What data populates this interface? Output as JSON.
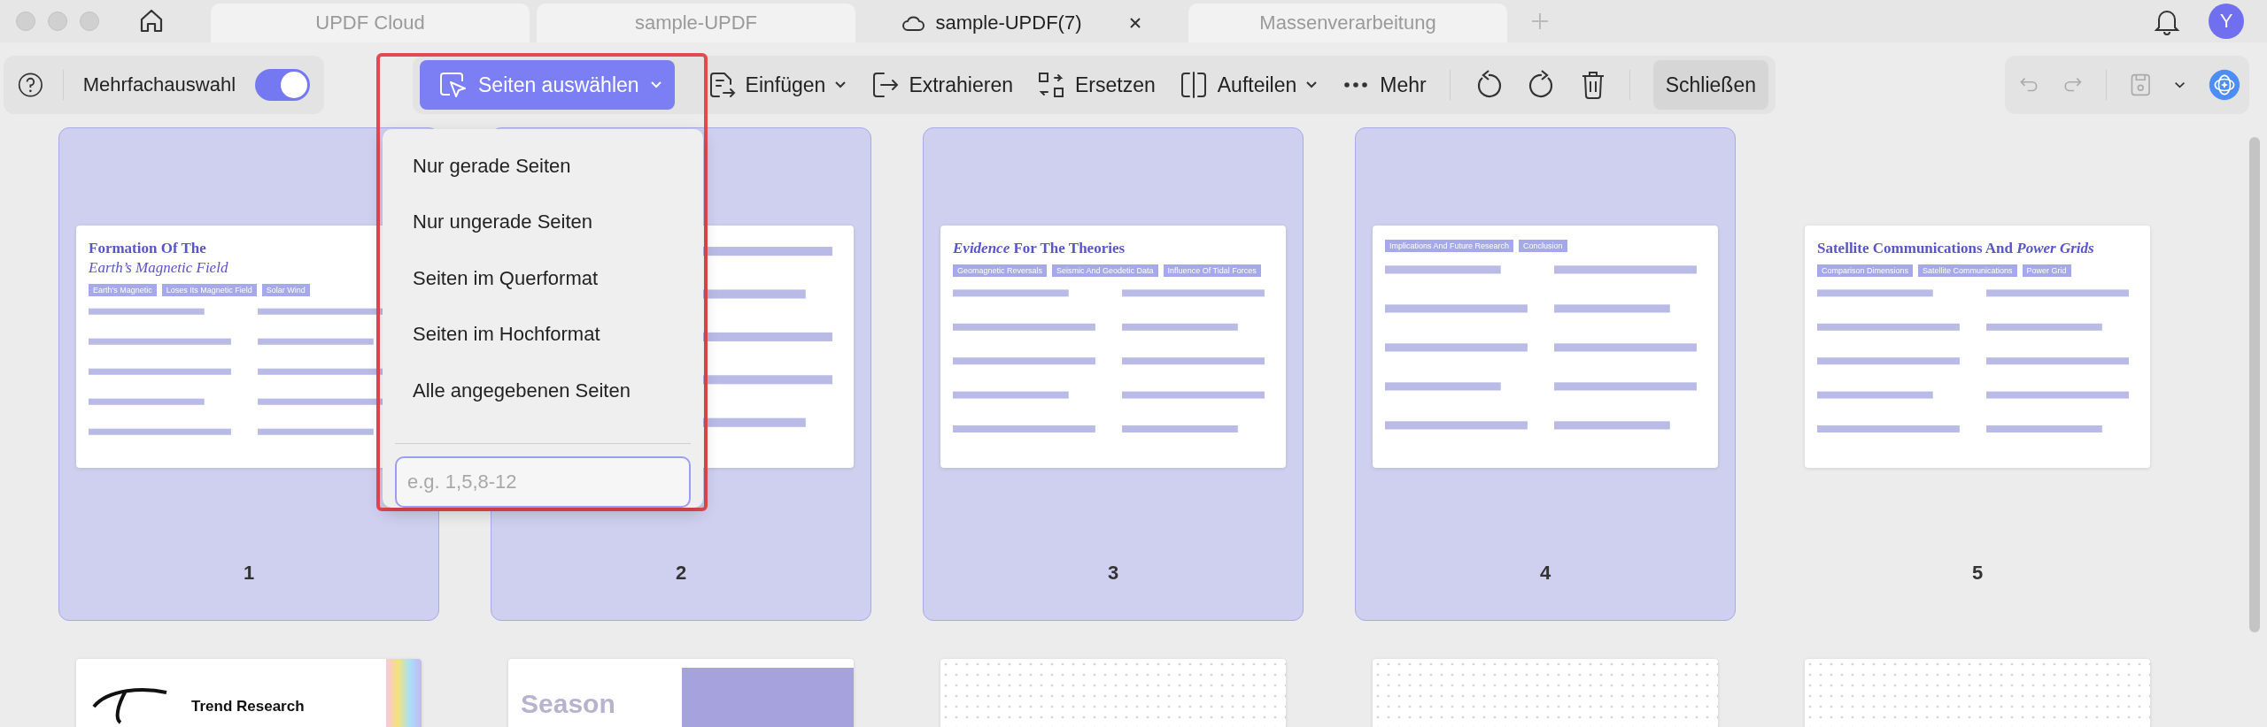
{
  "tabs": [
    {
      "label": "UPDF Cloud",
      "selected": false
    },
    {
      "label": "sample-UPDF",
      "selected": false
    },
    {
      "label": "sample-UPDF(7)",
      "selected": true
    },
    {
      "label": "Massenverarbeitung",
      "selected": false
    }
  ],
  "avatar": {
    "initial": "Y"
  },
  "toolbar": {
    "multi_select": {
      "label": "Mehrfachauswahl",
      "on": true
    },
    "select_pages": {
      "label": "Seiten auswählen",
      "expanded": true
    },
    "tools": [
      {
        "kind": "insert",
        "label": "Einfügen",
        "dropdown": true
      },
      {
        "kind": "extract",
        "label": "Extrahieren",
        "dropdown": false
      },
      {
        "kind": "replace",
        "label": "Ersetzen",
        "dropdown": false
      },
      {
        "kind": "split",
        "label": "Aufteilen",
        "dropdown": true
      },
      {
        "kind": "more",
        "label": "Mehr",
        "dropdown": false
      }
    ],
    "close_button": "Schließen"
  },
  "select_menu": {
    "items": [
      "Nur gerade Seiten",
      "Nur ungerade Seiten",
      "Seiten im Querformat",
      "Seiten im Hochformat",
      "Alle angegebenen Seiten"
    ],
    "range_field": {
      "placeholder": "e.g. 1,5,8-12"
    }
  },
  "pages": [
    {
      "number": "1",
      "selected": true,
      "title": "Formation Of The",
      "subtitle": "Earth’s Magnetic Field",
      "tags": [
        "Earth's Magnetic",
        "Loses Its Magnetic Field",
        "Solar Wind"
      ]
    },
    {
      "number": "2",
      "selected": true
    },
    {
      "number": "3",
      "selected": true,
      "title": "*Evidence* For The Theories",
      "tags": [
        "Geomagnetic Reversals",
        "Seismic And Geodetic Data",
        "Influence Of Tidal Forces"
      ]
    },
    {
      "number": "4",
      "selected": true,
      "tags": [
        "Implications And Future Research",
        "Conclusion"
      ]
    },
    {
      "number": "5",
      "selected": false,
      "title": "Satellite Communications And *Power Grids*",
      "tags": [
        "Comparison Dimensions",
        "Satellite Communications",
        "Power Grid"
      ]
    }
  ],
  "next_row": [
    {
      "kind": "cover",
      "title": "Trend Research"
    },
    {
      "kind": "photo",
      "title": "Season"
    },
    {
      "kind": "dotted"
    },
    {
      "kind": "dotted"
    },
    {
      "kind": "dotted"
    }
  ]
}
